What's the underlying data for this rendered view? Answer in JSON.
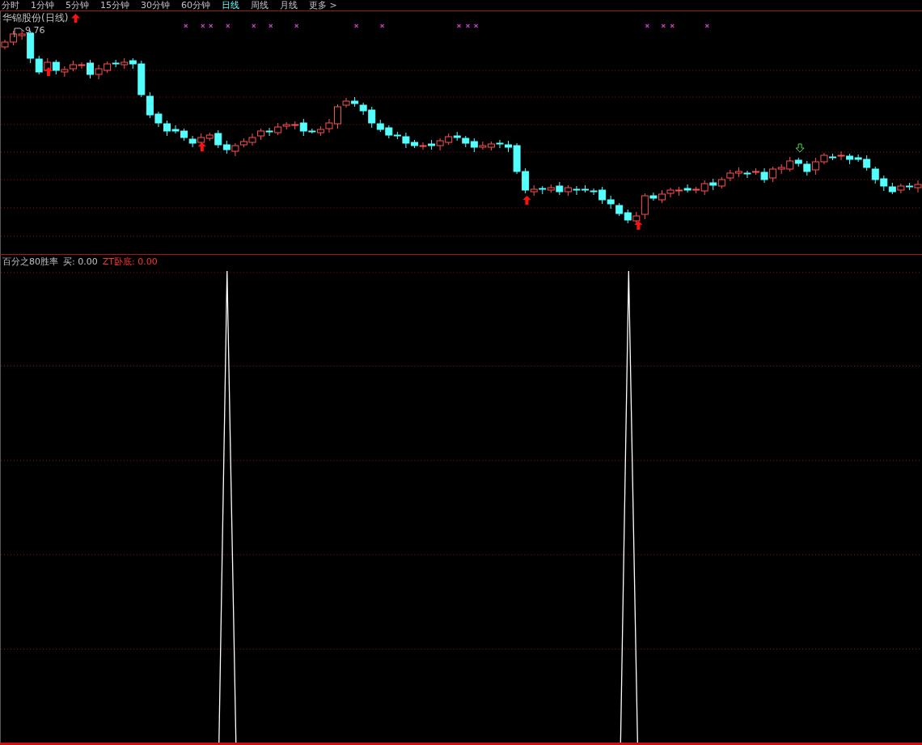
{
  "tabs": [
    {
      "label": "分时",
      "selected": false
    },
    {
      "label": "1分钟",
      "selected": false
    },
    {
      "label": "5分钟",
      "selected": false
    },
    {
      "label": "15分钟",
      "selected": false
    },
    {
      "label": "30分钟",
      "selected": false
    },
    {
      "label": "60分钟",
      "selected": false
    },
    {
      "label": "日线",
      "selected": true
    },
    {
      "label": "周线",
      "selected": false
    },
    {
      "label": "月线",
      "selected": false
    },
    {
      "label": "更多 >",
      "selected": false
    }
  ],
  "main_chart": {
    "title": "华锦股份(日线)",
    "high_label": "9.76"
  },
  "indicator": {
    "items": [
      {
        "text": "百分之80胜率",
        "color": "#c0c0c0"
      },
      {
        "text": "买: 0.00",
        "color": "#c0c0c0"
      },
      {
        "text": "ZT卧底: 0.00",
        "color": "#ff3232"
      }
    ]
  }
}
